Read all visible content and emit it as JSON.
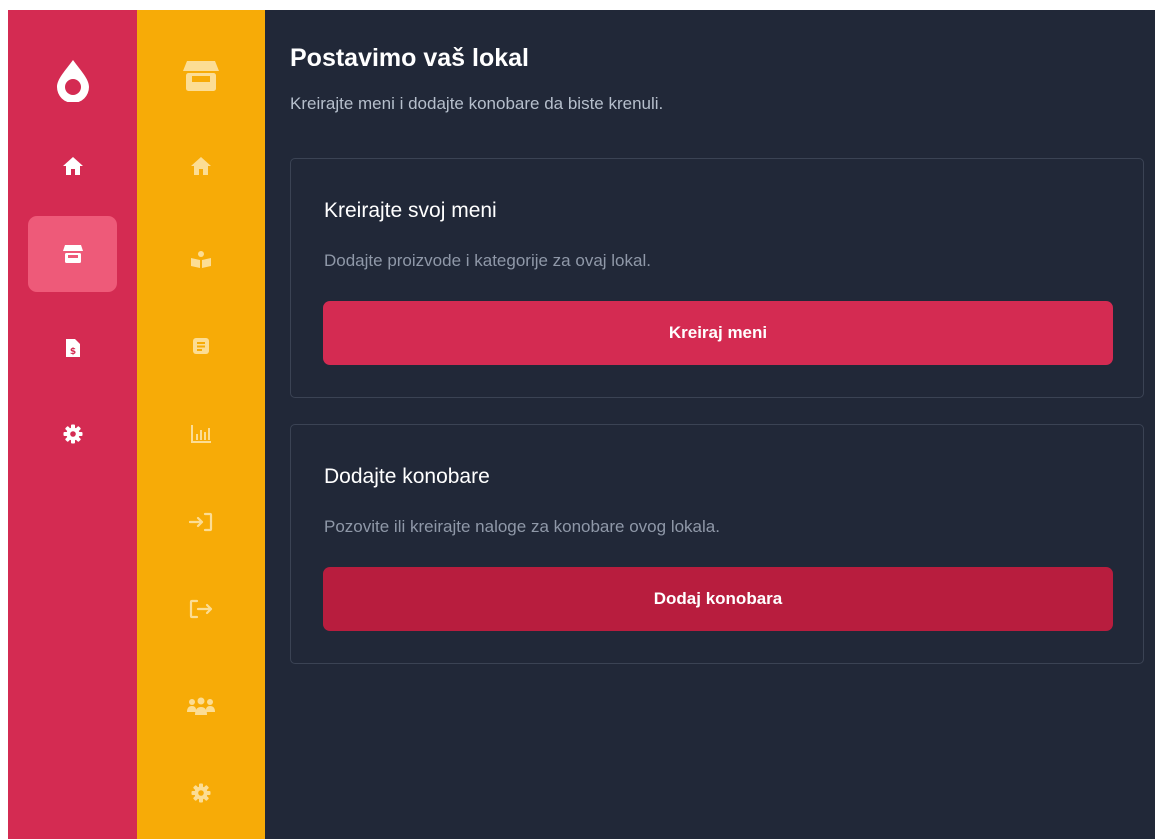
{
  "sidebar_primary": {
    "logo": "drop-logo-icon",
    "items": [
      {
        "icon": "home-icon",
        "active": false
      },
      {
        "icon": "store-icon",
        "active": true
      },
      {
        "icon": "invoice-icon",
        "active": false
      },
      {
        "icon": "gear-icon",
        "active": false
      }
    ]
  },
  "sidebar_secondary": {
    "header_icon": "store-icon",
    "items": [
      {
        "icon": "home-icon"
      },
      {
        "icon": "menu-book-icon"
      },
      {
        "icon": "document-icon"
      },
      {
        "icon": "chart-icon"
      },
      {
        "icon": "login-icon"
      },
      {
        "icon": "logout-icon"
      },
      {
        "icon": "users-icon"
      },
      {
        "icon": "gear-icon"
      }
    ]
  },
  "main": {
    "title": "Postavimo vaš lokal",
    "subtitle": "Kreirajte meni i dodajte konobare da biste krenuli.",
    "cards": [
      {
        "title": "Kreirajte svoj meni",
        "description": "Dodajte proizvode i kategorije za ovaj lokal.",
        "button_label": "Kreiraj meni"
      },
      {
        "title": "Dodajte konobare",
        "description": "Pozovite ili kreirajte naloge za konobare ovog lokala.",
        "button_label": "Dodaj konobara"
      }
    ]
  },
  "colors": {
    "primary_sidebar": "#d42b52",
    "secondary_sidebar": "#f7ab07",
    "background": "#212838",
    "accent_button": "#d42b52",
    "secondary_button": "#b81d3e"
  }
}
